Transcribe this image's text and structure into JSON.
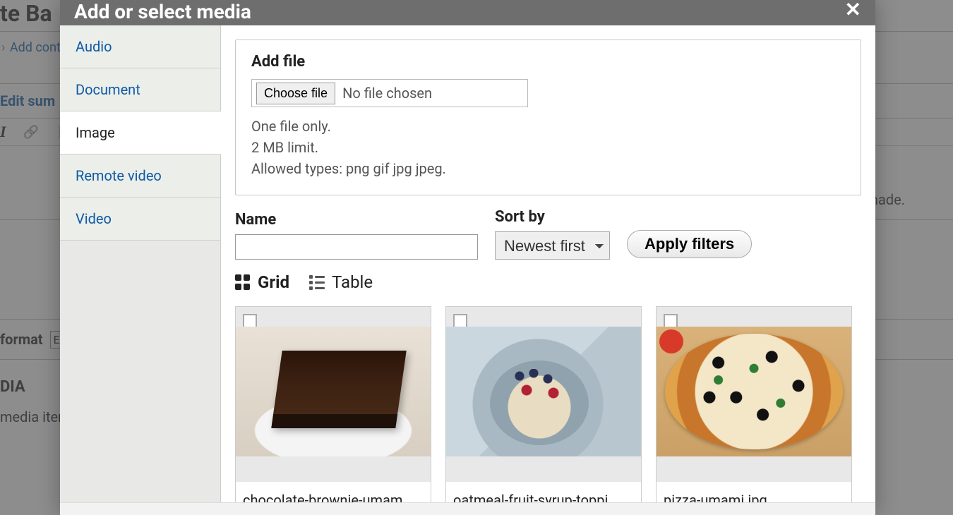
{
  "bg": {
    "title_fragment": "te Ba",
    "breadcrumb_item": "Add cont",
    "tab_label": "Edit sum",
    "body_text_fragment": "nade.",
    "format_label": "format",
    "format_value_initial": "E",
    "media_title_fragment": "DIA",
    "media_text_fragment": "media item"
  },
  "modal": {
    "title": "Add or select media",
    "close_label": "✕"
  },
  "sidebar": {
    "items": [
      {
        "label": "Audio",
        "active": false
      },
      {
        "label": "Document",
        "active": false
      },
      {
        "label": "Image",
        "active": true
      },
      {
        "label": "Remote video",
        "active": false
      },
      {
        "label": "Video",
        "active": false
      }
    ]
  },
  "addfile": {
    "legend": "Add file",
    "choose_label": "Choose file",
    "no_file": "No file chosen",
    "hint1": "One file only.",
    "hint2": "2 MB limit.",
    "hint3": "Allowed types: png gif jpg jpeg."
  },
  "filters": {
    "name_label": "Name",
    "name_value": "",
    "sort_label": "Sort by",
    "sort_selected": "Newest first",
    "apply_label": "Apply filters"
  },
  "views": {
    "grid": "Grid",
    "table": "Table",
    "active": "grid"
  },
  "gallery": [
    {
      "caption": "chocolate-brownie-umam…",
      "thumb": "brownie"
    },
    {
      "caption": "oatmeal-fruit-syrup-toppi…",
      "thumb": "oatmeal"
    },
    {
      "caption": "pizza-umami.jpg",
      "thumb": "pizza"
    }
  ]
}
